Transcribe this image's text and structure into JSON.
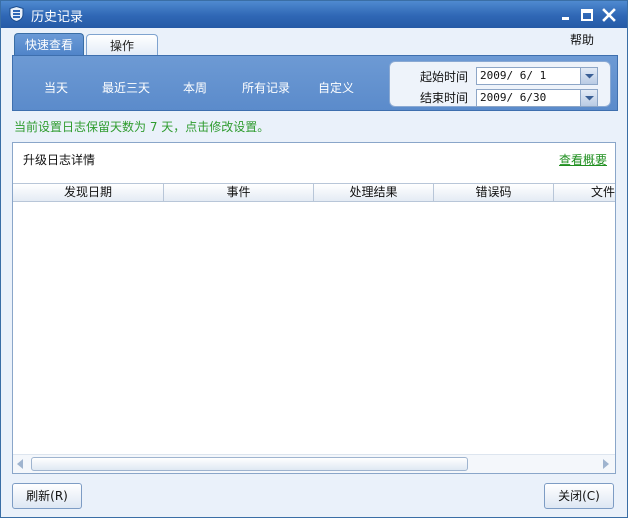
{
  "window": {
    "title": "历史记录"
  },
  "menu": {
    "help": "帮助"
  },
  "tabs": [
    {
      "label": "快速查看",
      "active": true
    },
    {
      "label": "操作",
      "active": false
    }
  ],
  "quick_ranges": [
    "当天",
    "最近三天",
    "本周",
    "所有记录",
    "自定义"
  ],
  "date_filter": {
    "start_label": "起始时间",
    "start_value": "2009/ 6/ 1",
    "end_label": "结束时间",
    "end_value": "2009/ 6/30"
  },
  "notice": "当前设置日志保留天数为 7 天，点击修改设置。",
  "panel": {
    "title": "升级日志详情",
    "summary_link": "查看概要",
    "columns": [
      "发现日期",
      "事件",
      "处理结果",
      "错误码",
      "文件"
    ]
  },
  "buttons": {
    "refresh": "刷新(R)",
    "close": "关闭(C)"
  },
  "colors": {
    "titlebar": "#2f67b5",
    "quickbar": "#5b8bcb",
    "notice": "#2f9c2f"
  }
}
